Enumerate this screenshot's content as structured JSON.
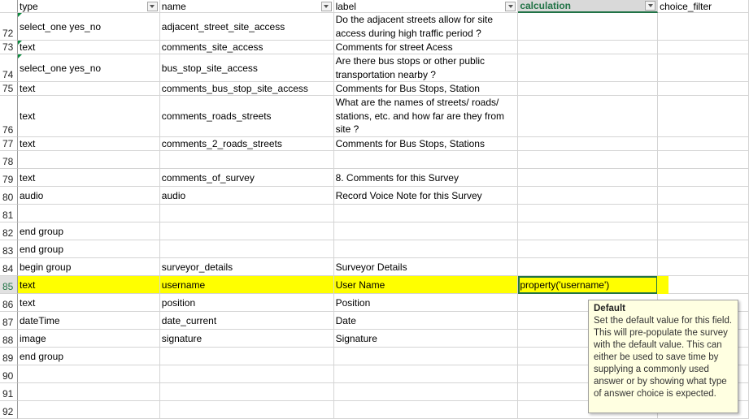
{
  "headers": [
    {
      "label": "type",
      "filter": true
    },
    {
      "label": "name",
      "filter": true
    },
    {
      "label": "label",
      "filter": true
    },
    {
      "label": "calculation",
      "filter": true
    },
    {
      "label": "choice_filter",
      "filter": false
    }
  ],
  "rows": [
    {
      "num": "72",
      "cells": [
        "select_one yes_no",
        "adjacent_street_site_access",
        "Do the adjacent streets allow for site access during high traffic period ?",
        "",
        ""
      ],
      "marker": true
    },
    {
      "num": "73",
      "cells": [
        "text",
        "comments_site_access",
        "Comments for street Acess",
        "",
        ""
      ],
      "marker": true
    },
    {
      "num": "74",
      "cells": [
        "select_one yes_no",
        "bus_stop_site_access",
        "Are there bus stops or other public transportation nearby ?",
        "",
        ""
      ],
      "marker": true
    },
    {
      "num": "75",
      "cells": [
        "text",
        "comments_bus_stop_site_access",
        "Comments for Bus Stops, Station",
        "",
        ""
      ],
      "marker": false
    },
    {
      "num": "76",
      "cells": [
        "text",
        "comments_roads_streets",
        "What are the names of streets/ roads/ stations, etc. and how far are they from site ?",
        "",
        ""
      ],
      "marker": false
    },
    {
      "num": "77",
      "cells": [
        "text",
        "comments_2_roads_streets",
        "Comments for Bus Stops, Stations",
        "",
        ""
      ],
      "marker": false
    },
    {
      "num": "78",
      "cells": [
        "",
        "",
        "",
        "",
        ""
      ],
      "marker": false
    },
    {
      "num": "79",
      "cells": [
        "text",
        "comments_of_survey",
        "8. Comments for this Survey",
        "",
        ""
      ],
      "marker": false
    },
    {
      "num": "80",
      "cells": [
        "audio",
        "audio",
        "Record Voice Note for this Survey",
        "",
        ""
      ],
      "marker": false
    },
    {
      "num": "81",
      "cells": [
        "",
        "",
        "",
        "",
        ""
      ],
      "marker": false
    },
    {
      "num": "82",
      "cells": [
        "end group",
        "",
        "",
        "",
        ""
      ],
      "marker": false
    },
    {
      "num": "83",
      "cells": [
        "end group",
        "",
        "",
        "",
        ""
      ],
      "marker": false
    },
    {
      "num": "84",
      "cells": [
        "begin group",
        "surveyor_details",
        "Surveyor Details",
        "",
        ""
      ],
      "marker": false
    },
    {
      "num": "85",
      "cells": [
        "text",
        "username",
        "User Name",
        "property('username')",
        ""
      ],
      "marker": false
    },
    {
      "num": "86",
      "cells": [
        "text",
        "position",
        "Position",
        "",
        ""
      ],
      "marker": false
    },
    {
      "num": "87",
      "cells": [
        "dateTime",
        "date_current",
        "Date",
        "",
        ""
      ],
      "marker": false
    },
    {
      "num": "88",
      "cells": [
        "image",
        "signature",
        "Signature",
        "",
        ""
      ],
      "marker": false
    },
    {
      "num": "89",
      "cells": [
        "end group",
        "",
        "",
        "",
        ""
      ],
      "marker": false
    },
    {
      "num": "90",
      "cells": [
        "",
        "",
        "",
        "",
        ""
      ],
      "marker": false
    },
    {
      "num": "91",
      "cells": [
        "",
        "",
        "",
        "",
        ""
      ],
      "marker": false
    },
    {
      "num": "92",
      "cells": [
        "",
        "",
        "",
        "",
        ""
      ],
      "marker": false
    }
  ],
  "highlight_row": "85",
  "highlight_color": "#ffff00",
  "accent_color": "#217346",
  "tooltip": {
    "title": "Default",
    "body": "Set the default value for this field. This will pre-populate the survey with the default value. This can either be used to save time by supplying a commonly used answer or by showing what type of answer choice is expected."
  }
}
